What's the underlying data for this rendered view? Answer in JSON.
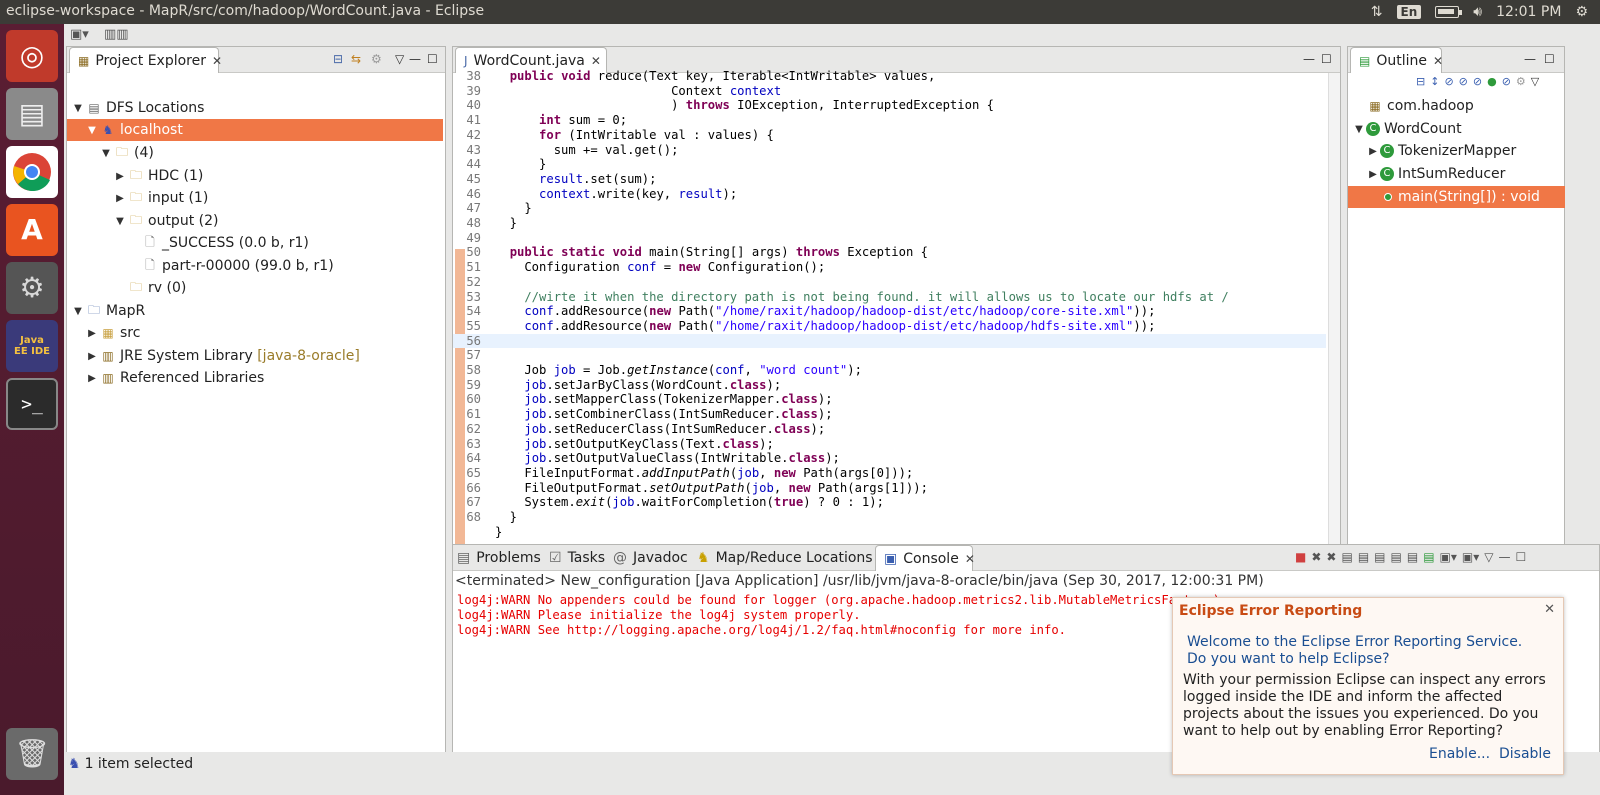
{
  "window": {
    "title": "eclipse-workspace - MapR/src/com/hadoop/WordCount.java - Eclipse",
    "keyboard": "En",
    "clock": "12:01 PM"
  },
  "launcher": [
    "ubuntu-icon",
    "files-icon",
    "chrome-icon",
    "software-center-icon",
    "settings-icon",
    "eclipse-jee-icon",
    "terminal-icon",
    "trash-icon"
  ],
  "launcher_text": {
    "eclipse_badge": "Java EE IDE"
  },
  "project_explorer": {
    "tab_label": "Project Explorer",
    "rows": [
      {
        "label": "DFS Locations",
        "extra": ""
      },
      {
        "label": "localhost",
        "extra": ""
      },
      {
        "label": "(4)",
        "extra": ""
      },
      {
        "label": "HDC (1)",
        "extra": ""
      },
      {
        "label": "input (1)",
        "extra": ""
      },
      {
        "label": "output (2)",
        "extra": ""
      },
      {
        "label": "_SUCCESS (0.0 b, r1)",
        "extra": ""
      },
      {
        "label": "part-r-00000 (99.0 b, r1)",
        "extra": ""
      },
      {
        "label": "rv (0)",
        "extra": ""
      },
      {
        "label": "MapR",
        "extra": ""
      },
      {
        "label": "src",
        "extra": ""
      },
      {
        "label": "JRE System Library",
        "extra": "[java-8-oracle]"
      },
      {
        "label": "Referenced Libraries",
        "extra": ""
      }
    ]
  },
  "editor": {
    "tab_label": "WordCount.java",
    "lines": [
      {
        "n": "38",
        "t": "  public void reduce(Text key, Iterable<IntWritable> values,"
      },
      {
        "n": "39",
        "t": "                        Context context"
      },
      {
        "n": "40",
        "t": "                        ) throws IOException, InterruptedException {"
      },
      {
        "n": "41",
        "t": "      int sum = 0;"
      },
      {
        "n": "42",
        "t": "      for (IntWritable val : values) {"
      },
      {
        "n": "43",
        "t": "        sum += val.get();"
      },
      {
        "n": "44",
        "t": "      }"
      },
      {
        "n": "45",
        "t": "      result.set(sum);"
      },
      {
        "n": "46",
        "t": "      context.write(key, result);"
      },
      {
        "n": "47",
        "t": "    }"
      },
      {
        "n": "48",
        "t": "  }"
      },
      {
        "n": "49",
        "t": ""
      },
      {
        "n": "50",
        "t": "  public static void main(String[] args) throws Exception {"
      },
      {
        "n": "51",
        "t": "    Configuration conf = new Configuration();"
      },
      {
        "n": "52",
        "t": ""
      },
      {
        "n": "53",
        "t": "    //wirte it when the directory path is not being found. it will allows us to locate our hdfs at /"
      },
      {
        "n": "54",
        "t": "    conf.addResource(new Path(\"/home/raxit/hadoop/hadoop-dist/etc/hadoop/core-site.xml\"));"
      },
      {
        "n": "55",
        "t": "    conf.addResource(new Path(\"/home/raxit/hadoop/hadoop-dist/etc/hadoop/hdfs-site.xml\"));"
      },
      {
        "n": "56",
        "t": ""
      },
      {
        "n": "57",
        "t": ""
      },
      {
        "n": "58",
        "t": "    Job job = Job.getInstance(conf, \"word count\");"
      },
      {
        "n": "59",
        "t": "    job.setJarByClass(WordCount.class);"
      },
      {
        "n": "60",
        "t": "    job.setMapperClass(TokenizerMapper.class);"
      },
      {
        "n": "61",
        "t": "    job.setCombinerClass(IntSumReducer.class);"
      },
      {
        "n": "62",
        "t": "    job.setReducerClass(IntSumReducer.class);"
      },
      {
        "n": "63",
        "t": "    job.setOutputKeyClass(Text.class);"
      },
      {
        "n": "64",
        "t": "    job.setOutputValueClass(IntWritable.class);"
      },
      {
        "n": "65",
        "t": "    FileInputFormat.addInputPath(job, new Path(args[0]));"
      },
      {
        "n": "66",
        "t": "    FileOutputFormat.setOutputPath(job, new Path(args[1]));"
      },
      {
        "n": "67",
        "t": "    System.exit(job.waitForCompletion(true) ? 0 : 1);"
      },
      {
        "n": "68",
        "t": "  }"
      },
      {
        "n": "",
        "t": "}"
      }
    ]
  },
  "outline": {
    "tab_label": "Outline",
    "rows": [
      {
        "label": "com.hadoop"
      },
      {
        "label": "WordCount"
      },
      {
        "label": "TokenizerMapper"
      },
      {
        "label": "IntSumReducer"
      },
      {
        "label": "main(String[]) : void"
      }
    ]
  },
  "bottom": {
    "tabs": [
      "Problems",
      "Tasks",
      "Javadoc",
      "Map/Reduce Locations",
      "Console"
    ],
    "terminated": "<terminated> New_configuration [Java Application] /usr/lib/jvm/java-8-oracle/bin/java (Sep 30, 2017, 12:00:31 PM)",
    "console_lines": [
      "log4j:WARN No appenders could be found for logger (org.apache.hadoop.metrics2.lib.MutableMetricsFactory).",
      "log4j:WARN Please initialize the log4j system properly.",
      "log4j:WARN See http://logging.apache.org/log4j/1.2/faq.html#noconfig for more info."
    ]
  },
  "popup": {
    "title": "Eclipse Error Reporting",
    "link1": "Welcome to the Eclipse Error Reporting Service.",
    "link2": "Do you want to help Eclipse?",
    "body": "With your permission Eclipse can inspect any errors logged inside the IDE and inform the affected projects about the issues you experienced. Do you want to help out by enabling Error Reporting?",
    "enable": "Enable...",
    "disable": "Disable"
  },
  "status": {
    "text": "1 item selected"
  },
  "colors": {
    "selection": "#f07746",
    "launcher": "#5a1d33",
    "topbar": "#3c3b37",
    "console_error": "#e60000"
  }
}
